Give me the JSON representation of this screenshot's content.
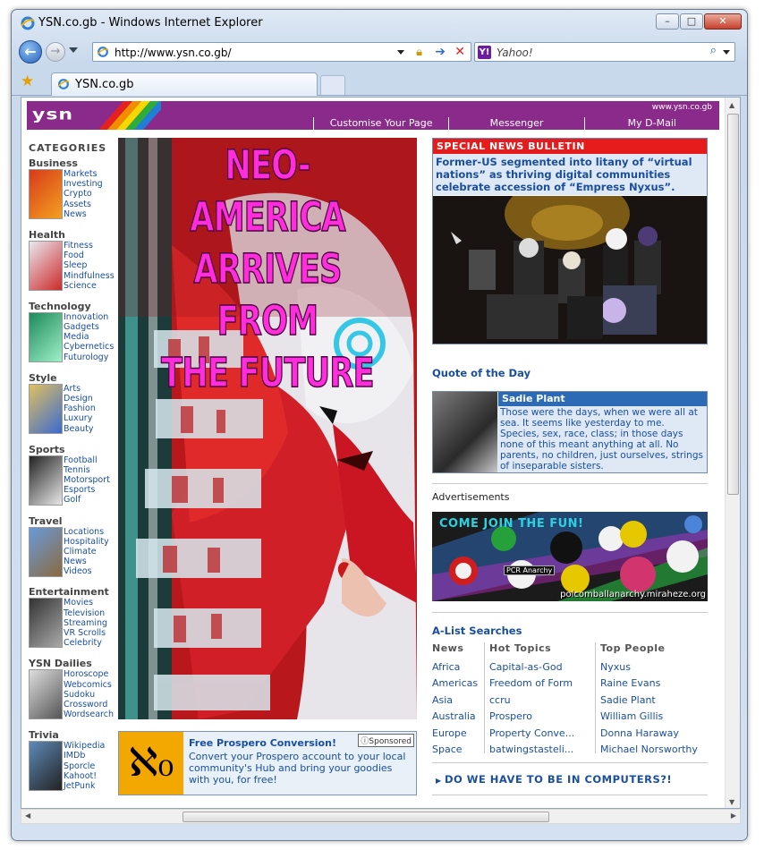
{
  "window": {
    "title": "YSN.co.gb - Windows Internet Explorer"
  },
  "toolbar": {
    "url": "http://www.ysn.co.gb/",
    "search_placeholder": "Yahoo!"
  },
  "tab": {
    "title": "YSN.co.gb"
  },
  "site": {
    "logo": "ysn",
    "domain": "www.ysn.co.gb",
    "top_links": [
      "Customise Your Page",
      "Messenger",
      "My D-Mail"
    ]
  },
  "categories": {
    "heading": "CATEGORIES",
    "items": [
      {
        "title": "Business",
        "links": [
          "Markets",
          "Investing",
          "Crypto",
          "Assets",
          "News"
        ]
      },
      {
        "title": "Health",
        "links": [
          "Fitness",
          "Food",
          "Sleep",
          "Mindfulness",
          "Science"
        ]
      },
      {
        "title": "Technology",
        "links": [
          "Innovation",
          "Gadgets",
          "Media",
          "Cybernetics",
          "Futurology"
        ]
      },
      {
        "title": "Style",
        "links": [
          "Arts",
          "Design",
          "Fashion",
          "Luxury",
          "Beauty"
        ]
      },
      {
        "title": "Sports",
        "links": [
          "Football",
          "Tennis",
          "Motorsport",
          "Esports",
          "Golf"
        ]
      },
      {
        "title": "Travel",
        "links": [
          "Locations",
          "Hospitality",
          "Climate",
          "News",
          "Videos"
        ]
      },
      {
        "title": "Entertainment",
        "links": [
          "Movies",
          "Television",
          "Streaming",
          "VR Scrolls",
          "Celebrity"
        ]
      },
      {
        "title": "YSN Dailies",
        "links": [
          "Horoscope",
          "Webcomics",
          "Sudoku",
          "Crossword",
          "Wordsearch"
        ]
      },
      {
        "title": "Trivia",
        "links": [
          "Wikipedia",
          "IMDb",
          "Sporcle",
          "Kahoot!",
          "JetPunk"
        ]
      }
    ]
  },
  "hero": {
    "line1": "NEO-AMERICA",
    "line2": "ARRIVES FROM",
    "line3": "THE FUTURE"
  },
  "sponsored": {
    "logo": "ℵ₀",
    "title": "Free Prospero Conversion!",
    "badge": "ⓘSponsored",
    "body": "Convert your Prospero account to your local community's Hub and bring your goodies with you, for free!"
  },
  "bulletin": {
    "header": "SPECIAL NEWS BULLETIN",
    "text": "Former-US segmented into litany of “virtual nations” as thriving digital communities celebrate accession of “Empress Nyxus”."
  },
  "quote": {
    "heading": "Quote of the Day",
    "author": "Sadie Plant",
    "text": "Those were the days, when we were all at sea. It seems like yesterday to me. Species, sex, race, class; in those days none of this meant anything at all. No  parents, no children, just ourselves, strings of inseparable sisters."
  },
  "ads": {
    "label": "Advertisements",
    "banner_text": "COME JOIN THE FUN!",
    "banner_tag": "PCR Anarchy",
    "banner_url": "polcomballanarchy.miraheze.org"
  },
  "alist": {
    "heading": "A-List Searches",
    "columns": [
      {
        "title": "News",
        "links": [
          "Africa",
          "Americas",
          "Asia",
          "Australia",
          "Europe",
          "Space"
        ]
      },
      {
        "title": "Hot Topics",
        "links": [
          "Capital-as-God",
          "Freedom of Form",
          "ccru",
          "Prospero",
          "Property Conve...",
          "batwingstasteli..."
        ]
      },
      {
        "title": "Top People",
        "links": [
          "Nyxus",
          "Raine Evans",
          "Sadie Plant",
          "William Gillis",
          "Donna Haraway",
          "Michael Norsworthy"
        ]
      }
    ]
  },
  "footer_link": "DO WE HAVE TO BE IN COMPUTERS?!"
}
